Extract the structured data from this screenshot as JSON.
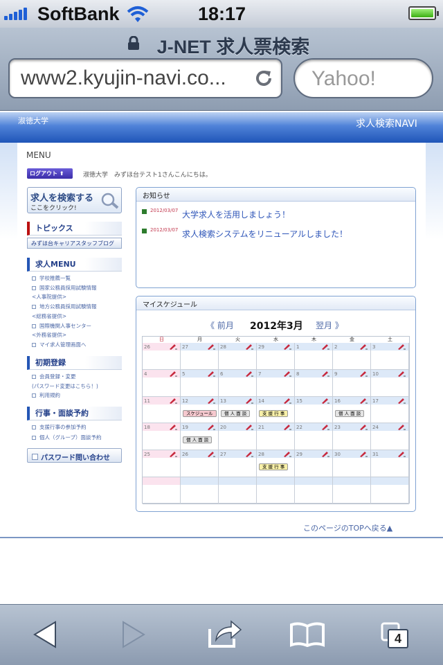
{
  "status": {
    "carrier": "SoftBank",
    "time": "18:17"
  },
  "browser": {
    "page_title": "J-NET 求人票検索",
    "url": "www2.kyujin-navi.co...",
    "search_placeholder": "Yahoo!",
    "tab_count": "4"
  },
  "site": {
    "university": "淑徳大学",
    "brand": "求人検索NAVI",
    "menu_label": "MENU",
    "logout": "ログアウト",
    "greeting": "淑徳大学　みずほ台テスト1さんこんにちは。",
    "search_button": {
      "title": "求人を検索する",
      "sub": "ここをクリック!"
    },
    "topics": {
      "heading": "トピックス",
      "blog": "みずほ台キャリアスタッフブログ"
    },
    "job_menu": {
      "heading": "求人MENU",
      "items": [
        "学校推薦一覧",
        "国家公務員採用試験情報",
        "<人事院提供>",
        "地方公務員採用試験情報",
        "<総務省提供>",
        "国際機関人事センター",
        "<外務省提供>",
        "マイ求人管理画面へ"
      ]
    },
    "registration": {
      "heading": "初期登録",
      "items": [
        "会員登録・変更",
        "(パスワード変更はこちら！)",
        "利用規約"
      ]
    },
    "events": {
      "heading": "行事・面談予約",
      "items": [
        "支援行事の参加予約",
        "個人（グループ）面談予約"
      ]
    },
    "password_button": "パスワード問い合わせ",
    "news": {
      "heading": "お知らせ",
      "items": [
        {
          "date": "2012/03/07",
          "text": "大学求人を活用しましょう！"
        },
        {
          "date": "2012/03/07",
          "text": "求人検索システムをリニューアルしました！"
        }
      ]
    },
    "schedule": {
      "heading": "マイスケジュール",
      "prev": "《 前月",
      "current": "2012年3月",
      "next": "翌月 》",
      "weekdays": [
        "日",
        "月",
        "火",
        "水",
        "木",
        "金",
        "土"
      ],
      "weeks": [
        [
          "26",
          "27",
          "28",
          "29",
          "1",
          "2",
          "3"
        ],
        [
          "4",
          "5",
          "6",
          "7",
          "8",
          "9",
          "10"
        ],
        [
          "11",
          "12",
          "13",
          "14",
          "15",
          "16",
          "17"
        ],
        [
          "18",
          "19",
          "20",
          "21",
          "22",
          "23",
          "24"
        ],
        [
          "25",
          "26",
          "27",
          "28",
          "29",
          "30",
          "31"
        ],
        [
          "",
          "",
          "",
          "",
          "",
          "",
          ""
        ]
      ],
      "events": [
        {
          "week": 2,
          "day": 1,
          "label": "スケジュール",
          "kind": "schedule"
        },
        {
          "week": 2,
          "day": 2,
          "label": "個 人 面 談",
          "kind": "interview"
        },
        {
          "week": 2,
          "day": 3,
          "label": "支 援 行 事",
          "kind": "support"
        },
        {
          "week": 2,
          "day": 5,
          "label": "個 人 面 談",
          "kind": "interview"
        },
        {
          "week": 3,
          "day": 1,
          "label": "個 人 面 談",
          "kind": "interview"
        },
        {
          "week": 4,
          "day": 3,
          "label": "支 援 行 事",
          "kind": "support"
        }
      ],
      "event_colors": {
        "schedule": "#f6c9cf",
        "interview": "#e4e4e4",
        "support": "#f8f0a8"
      }
    },
    "page_top": "このページのTOPへ戻る▲"
  }
}
